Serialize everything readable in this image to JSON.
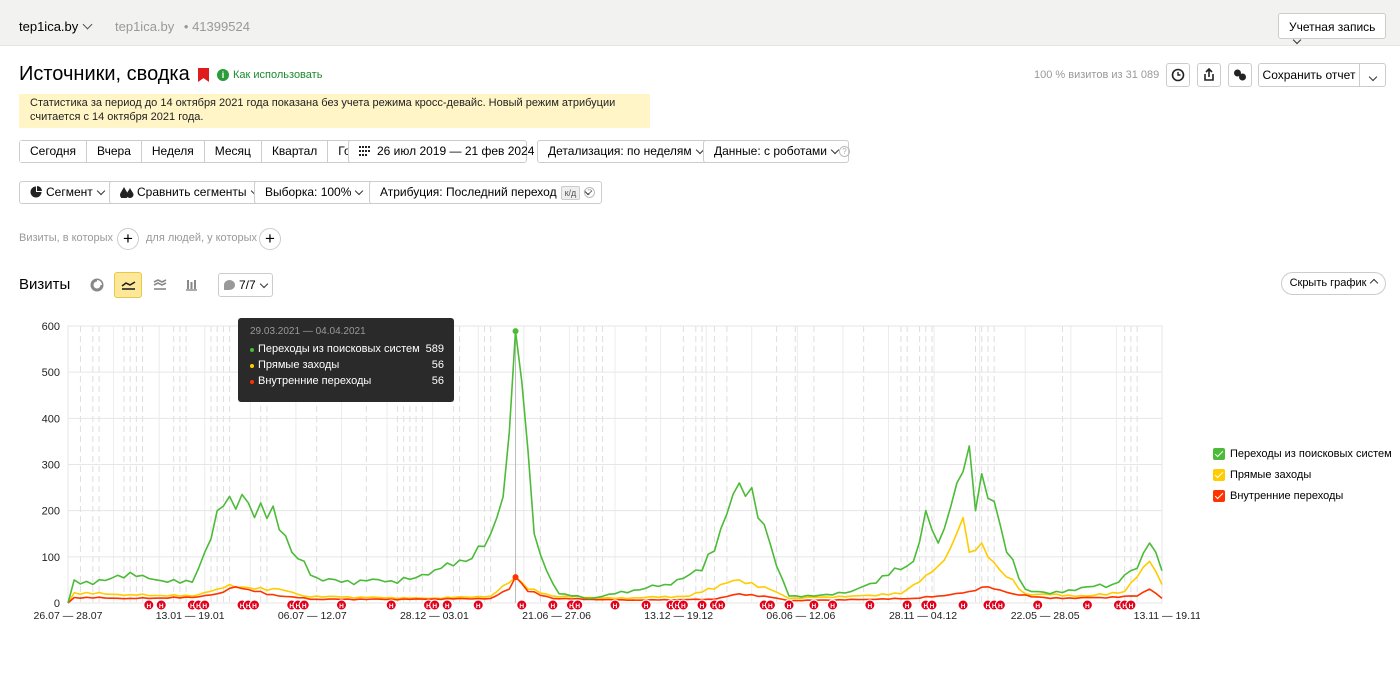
{
  "topbar": {
    "counter_name": "tep1ica.by",
    "counter_site": "tep1ica.by",
    "counter_sep": "•",
    "counter_id": "41399524",
    "account_label": "Учетная запись"
  },
  "header": {
    "title": "Источники, сводка",
    "howto_label": "Как использовать",
    "visits_share": "100 % визитов из 31 089",
    "save_label": "Сохранить отчет"
  },
  "notice": {
    "text": "Статистика за период до 14 октября 2021 года показана без учета режима кросс-девайс. Новый режим атрибуции считается с 14 октября 2021 года."
  },
  "periods": [
    "Сегодня",
    "Вчера",
    "Неделя",
    "Месяц",
    "Квартал",
    "Год"
  ],
  "filters": {
    "date_range": "26 июл 2019 — 21 фев 2024",
    "detail": "Детализация: по неделям",
    "data": "Данные: с роботами",
    "segment": "Сегмент",
    "compare": "Сравнить сегменты",
    "sample": "Выборка: 100%",
    "attribution": "Атрибуция: Последний переход",
    "attribution_tag": "к/д",
    "visits_where": "Визиты, в которых",
    "people_where": "для людей, у которых",
    "plus": "+"
  },
  "section": {
    "title": "Визиты",
    "series_count": "7/7",
    "hide_chart": "Скрыть график"
  },
  "tooltip": {
    "date": "29.03.2021 — 04.04.2021",
    "rows": [
      {
        "label": "Переходы из поисковых систем",
        "value": "589"
      },
      {
        "label": "Прямые заходы",
        "value": "56"
      },
      {
        "label": "Внутренние переходы",
        "value": "56"
      }
    ]
  },
  "colors": {
    "search": "#4cbb38",
    "direct": "#ffcc00",
    "internal": "#ff3300",
    "marker": "#e3001b",
    "accent": "#fde89a"
  },
  "chart_data": {
    "type": "line",
    "ylim": [
      0,
      600
    ],
    "y_ticks": [
      0,
      100,
      200,
      300,
      400,
      500,
      600
    ],
    "x_tick_labels": [
      "26.07 — 28.07",
      "13.01 — 19.01",
      "06.07 — 12.07",
      "28.12 — 03.01",
      "21.06 — 27.06",
      "13.12 — 19.12",
      "06.06 — 12.06",
      "28.11 — 04.12",
      "22.05 — 28.05",
      "13.11 — 19.11"
    ],
    "grid": true,
    "legend_position": "right",
    "highlighted_period": "29.03.2021 — 04.04.2021",
    "annotation_marker_label": "Н",
    "series": [
      {
        "name": "Переходы из поисковых систем",
        "color": "#4cbb38",
        "keypoints": [
          [
            0,
            0
          ],
          [
            1,
            50
          ],
          [
            4,
            40
          ],
          [
            8,
            60
          ],
          [
            12,
            60
          ],
          [
            16,
            45
          ],
          [
            20,
            45
          ],
          [
            22,
            110
          ],
          [
            25,
            210
          ],
          [
            28,
            235
          ],
          [
            30,
            185
          ],
          [
            33,
            210
          ],
          [
            36,
            110
          ],
          [
            40,
            55
          ],
          [
            44,
            45
          ],
          [
            48,
            48
          ],
          [
            52,
            48
          ],
          [
            56,
            55
          ],
          [
            60,
            75
          ],
          [
            64,
            90
          ],
          [
            68,
            150
          ],
          [
            70,
            230
          ],
          [
            71,
            370
          ],
          [
            72,
            589
          ],
          [
            74,
            330
          ],
          [
            75,
            150
          ],
          [
            77,
            70
          ],
          [
            79,
            20
          ],
          [
            84,
            10
          ],
          [
            88,
            20
          ],
          [
            96,
            40
          ],
          [
            102,
            70
          ],
          [
            105,
            160
          ],
          [
            108,
            260
          ],
          [
            110,
            250
          ],
          [
            112,
            170
          ],
          [
            114,
            80
          ],
          [
            116,
            15
          ],
          [
            120,
            15
          ],
          [
            126,
            25
          ],
          [
            132,
            60
          ],
          [
            136,
            90
          ],
          [
            138,
            200
          ],
          [
            140,
            130
          ],
          [
            143,
            260
          ],
          [
            145,
            340
          ],
          [
            146,
            200
          ],
          [
            147,
            280
          ],
          [
            149,
            220
          ],
          [
            151,
            110
          ],
          [
            154,
            30
          ],
          [
            158,
            20
          ],
          [
            164,
            35
          ],
          [
            168,
            40
          ],
          [
            172,
            75
          ],
          [
            174,
            130
          ],
          [
            175,
            110
          ],
          [
            176,
            70
          ]
        ]
      },
      {
        "name": "Прямые заходы",
        "color": "#ffcc00",
        "keypoints": [
          [
            0,
            0
          ],
          [
            1,
            22
          ],
          [
            10,
            18
          ],
          [
            20,
            15
          ],
          [
            24,
            30
          ],
          [
            26,
            40
          ],
          [
            30,
            30
          ],
          [
            34,
            30
          ],
          [
            38,
            15
          ],
          [
            48,
            12
          ],
          [
            58,
            10
          ],
          [
            68,
            15
          ],
          [
            72,
            56
          ],
          [
            74,
            30
          ],
          [
            78,
            15
          ],
          [
            88,
            10
          ],
          [
            100,
            15
          ],
          [
            105,
            40
          ],
          [
            108,
            50
          ],
          [
            112,
            35
          ],
          [
            116,
            10
          ],
          [
            126,
            15
          ],
          [
            134,
            20
          ],
          [
            138,
            60
          ],
          [
            140,
            80
          ],
          [
            142,
            120
          ],
          [
            144,
            185
          ],
          [
            145,
            110
          ],
          [
            147,
            130
          ],
          [
            150,
            70
          ],
          [
            154,
            20
          ],
          [
            164,
            15
          ],
          [
            170,
            25
          ],
          [
            174,
            90
          ],
          [
            176,
            40
          ]
        ]
      },
      {
        "name": "Внутренние переходы",
        "color": "#ff3300",
        "keypoints": [
          [
            0,
            0
          ],
          [
            1,
            12
          ],
          [
            10,
            10
          ],
          [
            20,
            12
          ],
          [
            24,
            20
          ],
          [
            27,
            35
          ],
          [
            30,
            25
          ],
          [
            34,
            15
          ],
          [
            40,
            8
          ],
          [
            55,
            8
          ],
          [
            68,
            10
          ],
          [
            71,
            30
          ],
          [
            72,
            56
          ],
          [
            74,
            25
          ],
          [
            78,
            10
          ],
          [
            90,
            6
          ],
          [
            104,
            8
          ],
          [
            108,
            20
          ],
          [
            112,
            15
          ],
          [
            116,
            5
          ],
          [
            130,
            8
          ],
          [
            136,
            10
          ],
          [
            140,
            15
          ],
          [
            145,
            25
          ],
          [
            148,
            35
          ],
          [
            152,
            20
          ],
          [
            158,
            10
          ],
          [
            166,
            12
          ],
          [
            172,
            15
          ],
          [
            174,
            30
          ],
          [
            176,
            10
          ]
        ]
      }
    ]
  }
}
